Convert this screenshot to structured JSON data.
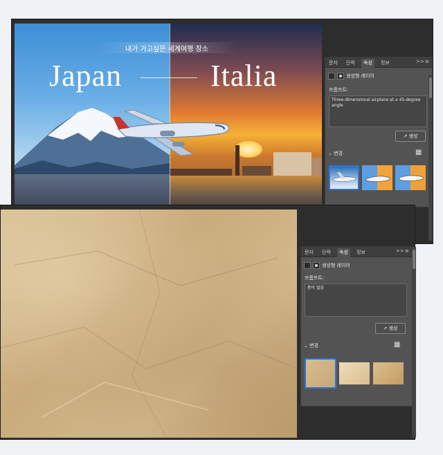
{
  "poster": {
    "subtitle": "내가 가고싶은 세계여행 장소",
    "left_title": "Japan",
    "right_title": "Italia"
  },
  "panel1": {
    "tabs": [
      "문자",
      "단락",
      "속성",
      "정보"
    ],
    "active_tab": "속성",
    "layer_type": "생성형 레이어",
    "prompt_label": "프롬프트:",
    "prompt_value": "Three-dimensional airplane at a 45-degree angle",
    "generate_label": "생성",
    "variations_label": "변경"
  },
  "panel2": {
    "tabs": [
      "문자",
      "단락",
      "속성",
      "정보"
    ],
    "active_tab": "속성",
    "layer_type": "생성형 레이어",
    "prompt_label": "프롬프트:",
    "prompt_value": "종이 질감",
    "generate_label": "생성",
    "variations_label": "변경"
  },
  "icons": {
    "panel_menu": ">>",
    "collapse": "chevron-down-icon",
    "grid": "grid-icon",
    "generate": "export-icon"
  },
  "colors": {
    "panel_bg": "#535353",
    "tabbar_bg": "#3e3e3e",
    "selection": "#2f73d9",
    "paper": "#d4b98c"
  }
}
